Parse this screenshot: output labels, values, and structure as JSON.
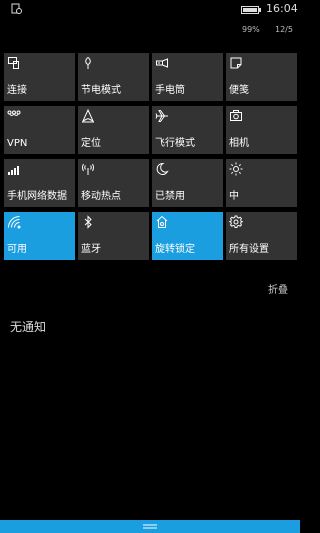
{
  "status_bar": {
    "time": "16:04",
    "battery_percent": "99%",
    "date": "12/5",
    "battery_level": 0.99
  },
  "quick_actions": [
    {
      "label": "连接",
      "icon": "connect-icon",
      "active": false
    },
    {
      "label": "节电模式",
      "icon": "battery-saver-icon",
      "active": false
    },
    {
      "label": "手电筒",
      "icon": "flashlight-icon",
      "active": false
    },
    {
      "label": "便笺",
      "icon": "note-icon",
      "active": false
    },
    {
      "label": "VPN",
      "icon": "vpn-icon",
      "active": false
    },
    {
      "label": "定位",
      "icon": "location-icon",
      "active": false
    },
    {
      "label": "飞行模式",
      "icon": "airplane-icon",
      "active": false
    },
    {
      "label": "相机",
      "icon": "camera-icon",
      "active": false
    },
    {
      "label": "手机网络数据",
      "icon": "cellular-icon",
      "active": false
    },
    {
      "label": "移动热点",
      "icon": "hotspot-icon",
      "active": false
    },
    {
      "label": "已禁用",
      "icon": "moon-icon",
      "active": false
    },
    {
      "label": "中",
      "icon": "brightness-icon",
      "active": false
    },
    {
      "label": "可用",
      "icon": "wifi-icon",
      "active": true
    },
    {
      "label": "蓝牙",
      "icon": "bluetooth-icon",
      "active": false
    },
    {
      "label": "旋转锁定",
      "icon": "rotation-lock-icon",
      "active": true
    },
    {
      "label": "所有设置",
      "icon": "gear-icon",
      "active": false
    }
  ],
  "collapse_label": "折叠",
  "notifications_empty_label": "无通知",
  "colors": {
    "accent": "#1a9ee0",
    "tile": "#333333",
    "background": "#000000"
  }
}
